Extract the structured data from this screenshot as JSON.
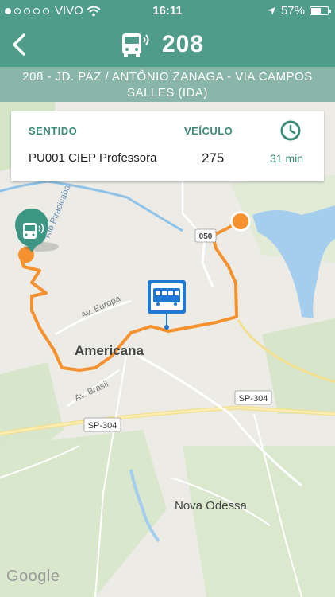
{
  "status_bar": {
    "carrier": "VIVO",
    "time": "16:11",
    "battery": "57%"
  },
  "header": {
    "route_number": "208"
  },
  "route_name": "208 - JD. PAZ / ANTÔNIO ZANAGA - VIA CAMPOS SALLES (IDA)",
  "info": {
    "sentido_label": "SENTIDO",
    "sentido_value": "PU001 CIEP Professora",
    "veiculo_label": "VEÍCULO",
    "veiculo_value": "275",
    "eta_value": "31 min"
  },
  "map": {
    "labels": {
      "river": "Rio Piracicaba",
      "city": "Americana",
      "av_europa": "Av. Europa",
      "av_brasil": "Av. Brasil",
      "road_050": "050",
      "sp304_a": "SP-304",
      "sp304_b": "SP-304",
      "nova_odessa": "Nova Odessa"
    },
    "attribution": "Google"
  },
  "colors": {
    "primary": "#4f9c8a",
    "route": "#f5922f",
    "bus_stop": "#1f78d1"
  }
}
